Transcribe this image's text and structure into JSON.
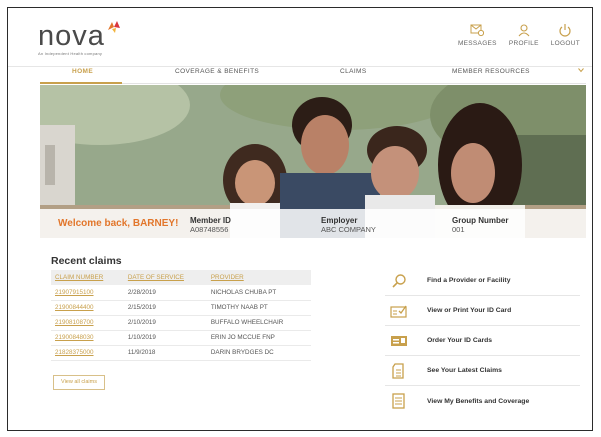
{
  "brand": {
    "name": "nova",
    "tagline": "An Independent Health company",
    "accent": "#c8a04c",
    "orange": "#e2762b"
  },
  "header": {
    "actions": [
      {
        "label": "MESSAGES",
        "icon": "messages-icon"
      },
      {
        "label": "PROFILE",
        "icon": "profile-icon"
      },
      {
        "label": "LOGOUT",
        "icon": "power-icon"
      }
    ]
  },
  "nav": {
    "items": [
      {
        "label": "HOME",
        "active": true
      },
      {
        "label": "COVERAGE & BENEFITS",
        "active": false
      },
      {
        "label": "CLAIMS",
        "active": false
      },
      {
        "label": "MEMBER RESOURCES",
        "active": false
      }
    ],
    "more_icon": "chevron-down-icon"
  },
  "member": {
    "welcome": "Welcome back, BARNEY!",
    "member_id_label": "Member ID",
    "member_id": "A08748556",
    "employer_label": "Employer",
    "employer": "ABC COMPANY",
    "group_label": "Group Number",
    "group": "001"
  },
  "claims": {
    "title": "Recent claims",
    "headers": [
      "CLAIM NUMBER",
      "DATE OF SERVICE",
      "PROVIDER"
    ],
    "rows": [
      [
        "21907915100",
        "2/28/2019",
        "NICHOLAS CHUBA PT"
      ],
      [
        "21900844400",
        "2/15/2019",
        "TIMOTHY NAAB PT"
      ],
      [
        "21908108700",
        "2/10/2019",
        "BUFFALO WHEELCHAIR"
      ],
      [
        "21900848030",
        "1/10/2019",
        "ERIN JO MCCUE FNP"
      ],
      [
        "21828375000",
        "11/9/2018",
        "DARIN BRYDGES DC"
      ]
    ],
    "view_all": "View all claims"
  },
  "quick_links": [
    {
      "label": "Find a Provider or Facility",
      "icon": "search-icon"
    },
    {
      "label": "View or Print Your ID Card",
      "icon": "id-card-check-icon"
    },
    {
      "label": "Order Your ID Cards",
      "icon": "id-card-icon"
    },
    {
      "label": "See Your Latest Claims",
      "icon": "document-icon"
    },
    {
      "label": "View My Benefits and Coverage",
      "icon": "list-document-icon"
    }
  ]
}
